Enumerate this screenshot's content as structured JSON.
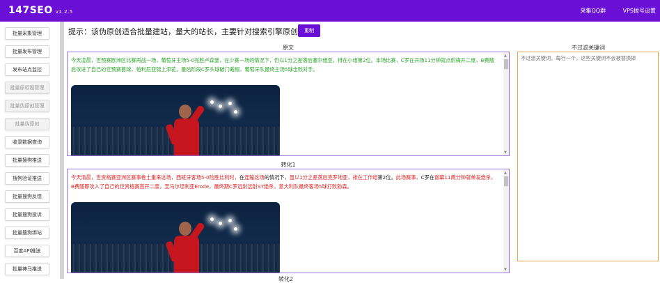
{
  "app": {
    "title": "147SEO",
    "version": "v1.2.5"
  },
  "topnav": {
    "qq_group": "采集QQ群",
    "vps": "VPS拨号设置"
  },
  "sidebar": {
    "items": [
      {
        "label": "批量采集管理",
        "disabled": false
      },
      {
        "label": "批量发布管理",
        "disabled": false
      },
      {
        "label": "发布站点监控",
        "disabled": false
      },
      {
        "label": "批量原标题管理",
        "disabled": true
      },
      {
        "label": "批量伪原创管理",
        "disabled": true
      },
      {
        "label": "批量伪原创",
        "disabled": true
      },
      {
        "label": "收录数据查询",
        "disabled": false
      },
      {
        "label": "批量搜狗推送",
        "disabled": false
      },
      {
        "label": "搜狗验证推送",
        "disabled": false
      },
      {
        "label": "批量搜狗反馈",
        "disabled": false
      },
      {
        "label": "批量搜狗投诉",
        "disabled": false
      },
      {
        "label": "批量搜狗绑站",
        "disabled": false
      },
      {
        "label": "百度API推送",
        "disabled": false
      },
      {
        "label": "批量神马推送",
        "disabled": false
      }
    ]
  },
  "main": {
    "hint": "提示：该伪原创适合批量建站，量大的站长，主要针对搜索引擎原创识别",
    "reset_label": "重制",
    "original": {
      "title": "原文",
      "p1": "今天凌晨，世预赛欧洲区比赛再战一场，葡萄牙主场5-0完胜卢森堡，在少赛一场的情况下，仍以1分之差落后塞尔维亚，排在小组第2位。",
      "p2": "本场比赛，C罗在开场11分钟就点射",
      "p3": "梅开二度，B费随后攻进了自己的世预赛首球，帕利尼亚锦上添花，最后阶段C罗头球破门戴帽，葡萄牙队最终主场5球击败对手。"
    },
    "converted": {
      "title": "转化1",
      "segments": [
        {
          "t": "今天清晨，世资格赛亚洲区赛事卷土重来这场，",
          "c": "r"
        },
        {
          "t": "西班牙客场5-0险胜比利时，",
          "c": "r"
        },
        {
          "t": "在",
          "c": "k"
        },
        {
          "t": "连输这场",
          "c": "r"
        },
        {
          "t": "的情况下，",
          "c": "k"
        },
        {
          "t": "虽以1分之差",
          "c": "r"
        },
        {
          "t": "落后克罗地亚，排在",
          "c": "r"
        },
        {
          "t": "工作组",
          "c": "r"
        },
        {
          "t": "第2位。",
          "c": "k"
        },
        {
          "t": "此场赛事，",
          "c": "r"
        },
        {
          "t": "C罗在",
          "c": "k"
        },
        {
          "t": "谢幕11两分钟就单发绝杀，",
          "c": "r"
        },
        {
          "t": "B费随即攻入了自己的世资格赛首开二度，",
          "c": "r"
        },
        {
          "t": "圣马尔坦利亚Erode，",
          "c": "r"
        },
        {
          "t": "最终期C罗远射远射ST绝杀，",
          "c": "r"
        },
        {
          "t": "意大利队最终客场5球打败勃森。",
          "c": "r"
        }
      ]
    },
    "next_title": "转化2"
  },
  "filter": {
    "title": "不过滤关键词",
    "placeholder": "不过滤关键词，每行一个，这些关键词不会被替换掉"
  },
  "colors": {
    "accent": "#6a0fd6",
    "green_text": "#2aa52a",
    "red_text": "#e02020",
    "filter_border": "#e8a34a"
  }
}
